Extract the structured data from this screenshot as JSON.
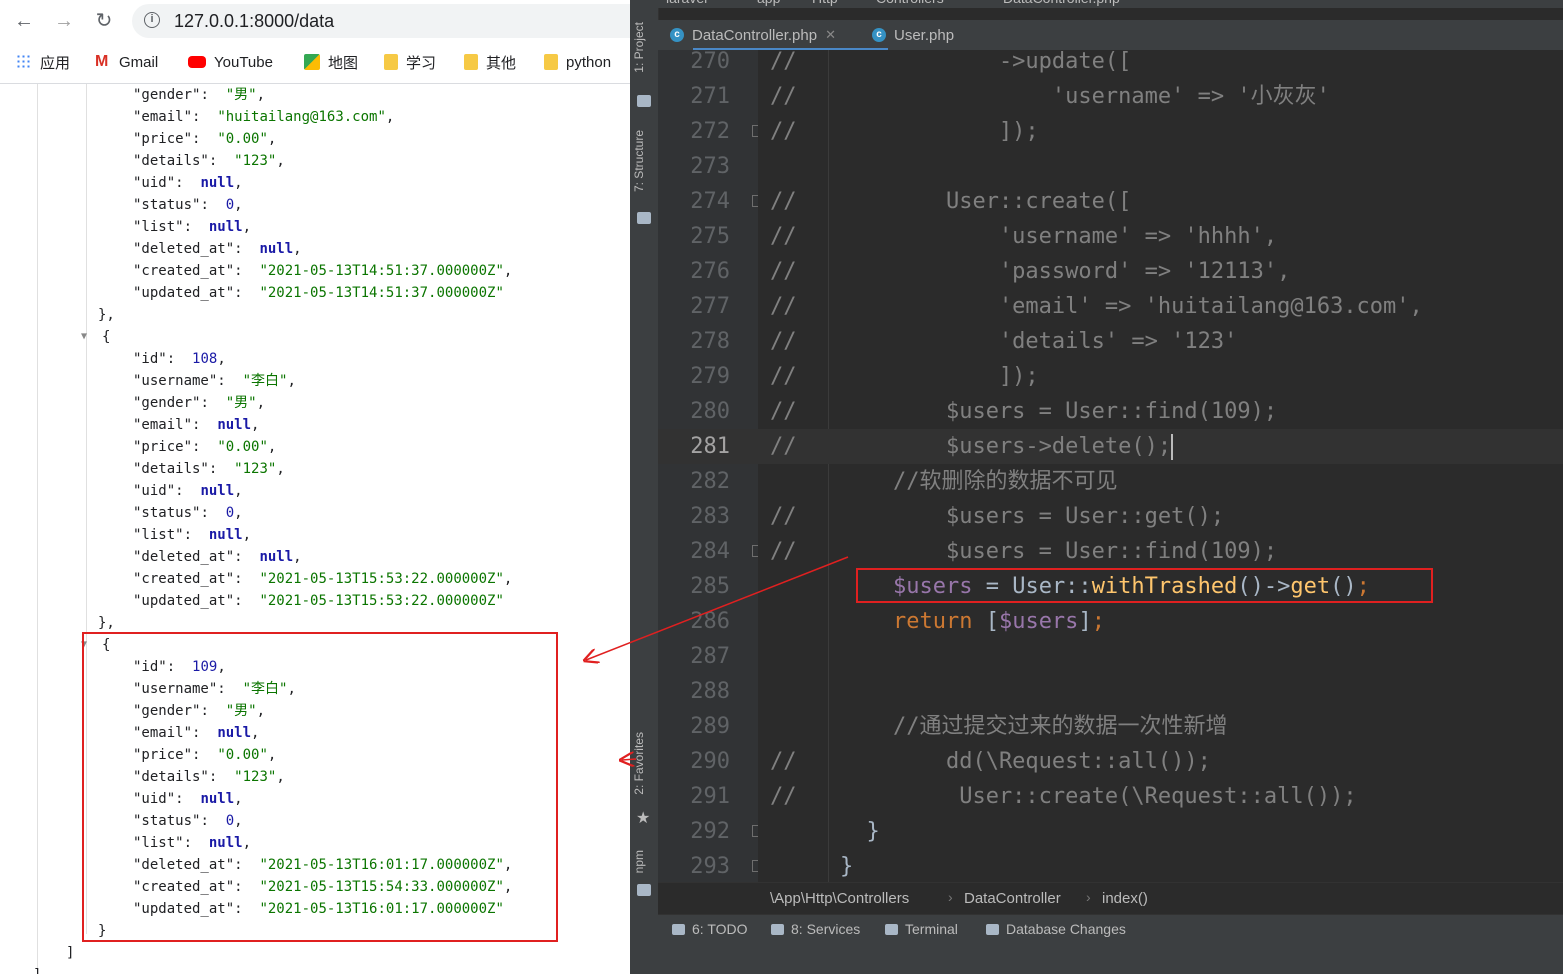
{
  "browser": {
    "url": "127.0.0.1:8000/data",
    "bookmarks": [
      {
        "label": "应用",
        "icon": "apps-grid-icon"
      },
      {
        "label": "Gmail",
        "icon": "gmail-icon"
      },
      {
        "label": "YouTube",
        "icon": "youtube-icon"
      },
      {
        "label": "地图",
        "icon": "maps-icon"
      },
      {
        "label": "学习",
        "icon": "folder-icon"
      },
      {
        "label": "其他",
        "icon": "folder-icon"
      },
      {
        "label": "python",
        "icon": "folder-icon"
      }
    ],
    "json_lines": [
      {
        "t": "kv",
        "key": "\"gender\"",
        "val": "\"男\"",
        "type": "s",
        "comma": true
      },
      {
        "t": "kv",
        "key": "\"email\"",
        "val": "\"huitailang@163.com\"",
        "type": "s",
        "comma": true
      },
      {
        "t": "kv",
        "key": "\"price\"",
        "val": "\"0.00\"",
        "type": "s",
        "comma": true
      },
      {
        "t": "kv",
        "key": "\"details\"",
        "val": "\"123\"",
        "type": "s",
        "comma": true
      },
      {
        "t": "kv",
        "key": "\"uid\"",
        "val": "null",
        "type": "nul",
        "comma": true
      },
      {
        "t": "kv",
        "key": "\"status\"",
        "val": "0",
        "type": "n",
        "comma": true
      },
      {
        "t": "kv",
        "key": "\"list\"",
        "val": "null",
        "type": "nul",
        "comma": true
      },
      {
        "t": "kv",
        "key": "\"deleted_at\"",
        "val": "null",
        "type": "nul",
        "comma": true
      },
      {
        "t": "kv",
        "key": "\"created_at\"",
        "val": "\"2021-05-13T14:51:37.000000Z\"",
        "type": "s",
        "comma": true
      },
      {
        "t": "kv",
        "key": "\"updated_at\"",
        "val": "\"2021-05-13T14:51:37.000000Z\"",
        "type": "s",
        "comma": false
      },
      {
        "t": "close",
        "text": "},"
      },
      {
        "t": "open",
        "text": "{"
      },
      {
        "t": "kv",
        "key": "\"id\"",
        "val": "108",
        "type": "n",
        "comma": true
      },
      {
        "t": "kv",
        "key": "\"username\"",
        "val": "\"李白\"",
        "type": "s",
        "comma": true
      },
      {
        "t": "kv",
        "key": "\"gender\"",
        "val": "\"男\"",
        "type": "s",
        "comma": true
      },
      {
        "t": "kv",
        "key": "\"email\"",
        "val": "null",
        "type": "nul",
        "comma": true
      },
      {
        "t": "kv",
        "key": "\"price\"",
        "val": "\"0.00\"",
        "type": "s",
        "comma": true
      },
      {
        "t": "kv",
        "key": "\"details\"",
        "val": "\"123\"",
        "type": "s",
        "comma": true
      },
      {
        "t": "kv",
        "key": "\"uid\"",
        "val": "null",
        "type": "nul",
        "comma": true
      },
      {
        "t": "kv",
        "key": "\"status\"",
        "val": "0",
        "type": "n",
        "comma": true
      },
      {
        "t": "kv",
        "key": "\"list\"",
        "val": "null",
        "type": "nul",
        "comma": true
      },
      {
        "t": "kv",
        "key": "\"deleted_at\"",
        "val": "null",
        "type": "nul",
        "comma": true
      },
      {
        "t": "kv",
        "key": "\"created_at\"",
        "val": "\"2021-05-13T15:53:22.000000Z\"",
        "type": "s",
        "comma": true
      },
      {
        "t": "kv",
        "key": "\"updated_at\"",
        "val": "\"2021-05-13T15:53:22.000000Z\"",
        "type": "s",
        "comma": false
      },
      {
        "t": "close",
        "text": "},"
      },
      {
        "t": "open",
        "text": "{"
      },
      {
        "t": "kv",
        "key": "\"id\"",
        "val": "109",
        "type": "n",
        "comma": true
      },
      {
        "t": "kv",
        "key": "\"username\"",
        "val": "\"李白\"",
        "type": "s",
        "comma": true
      },
      {
        "t": "kv",
        "key": "\"gender\"",
        "val": "\"男\"",
        "type": "s",
        "comma": true
      },
      {
        "t": "kv",
        "key": "\"email\"",
        "val": "null",
        "type": "nul",
        "comma": true
      },
      {
        "t": "kv",
        "key": "\"price\"",
        "val": "\"0.00\"",
        "type": "s",
        "comma": true
      },
      {
        "t": "kv",
        "key": "\"details\"",
        "val": "\"123\"",
        "type": "s",
        "comma": true
      },
      {
        "t": "kv",
        "key": "\"uid\"",
        "val": "null",
        "type": "nul",
        "comma": true
      },
      {
        "t": "kv",
        "key": "\"status\"",
        "val": "0",
        "type": "n",
        "comma": true
      },
      {
        "t": "kv",
        "key": "\"list\"",
        "val": "null",
        "type": "nul",
        "comma": true
      },
      {
        "t": "kv",
        "key": "\"deleted_at\"",
        "val": "\"2021-05-13T16:01:17.000000Z\"",
        "type": "s",
        "comma": true
      },
      {
        "t": "kv",
        "key": "\"created_at\"",
        "val": "\"2021-05-13T15:54:33.000000Z\"",
        "type": "s",
        "comma": true
      },
      {
        "t": "kv",
        "key": "\"updated_at\"",
        "val": "\"2021-05-13T16:01:17.000000Z\"",
        "type": "s",
        "comma": false
      },
      {
        "t": "close",
        "text": "}"
      },
      {
        "t": "close2",
        "text": "]"
      },
      {
        "t": "close3",
        "text": "]"
      }
    ]
  },
  "ide": {
    "top_breadcrumb": [
      "laravel",
      "app",
      "Http",
      "Controllers",
      "DataController.php"
    ],
    "tabs": [
      {
        "label": "DataController.php",
        "active": true
      },
      {
        "label": "User.php",
        "active": false
      }
    ],
    "side_tabs": {
      "project": "1: Project",
      "structure": "7: Structure",
      "favorites": "2: Favorites",
      "npm": "npm"
    },
    "current_line": 281,
    "lines": [
      {
        "n": 270,
        "c": "//",
        "code": [
          [
            "cmt",
            "            ->update(["
          ]
        ]
      },
      {
        "n": 271,
        "c": "//",
        "code": [
          [
            "cmt",
            "                'username' => '小灰灰'"
          ]
        ]
      },
      {
        "n": 272,
        "c": "//",
        "code": [
          [
            "cmt",
            "            ]);"
          ]
        ]
      },
      {
        "n": 273,
        "c": "",
        "code": []
      },
      {
        "n": 274,
        "c": "//",
        "code": [
          [
            "cmt",
            "        User::create(["
          ]
        ]
      },
      {
        "n": 275,
        "c": "//",
        "code": [
          [
            "cmt",
            "            'username' => 'hhhh',"
          ]
        ]
      },
      {
        "n": 276,
        "c": "//",
        "code": [
          [
            "cmt",
            "            'password' => '12113',"
          ]
        ]
      },
      {
        "n": 277,
        "c": "//",
        "code": [
          [
            "cmt",
            "            'email' => 'huitailang@163.com',"
          ]
        ]
      },
      {
        "n": 278,
        "c": "//",
        "code": [
          [
            "cmt",
            "            'details' => '123'"
          ]
        ]
      },
      {
        "n": 279,
        "c": "//",
        "code": [
          [
            "cmt",
            "            ]);"
          ]
        ]
      },
      {
        "n": 280,
        "c": "//",
        "code": [
          [
            "cmt",
            "        $users = User::find(109);"
          ]
        ]
      },
      {
        "n": 281,
        "c": "//",
        "code": [
          [
            "cmt",
            "        $users->delete();"
          ]
        ]
      },
      {
        "n": 282,
        "c": "",
        "code": [
          [
            "cmt",
            "    //软删除的数据不可见"
          ]
        ]
      },
      {
        "n": 283,
        "c": "//",
        "code": [
          [
            "cmt",
            "        $users = User::get();"
          ]
        ]
      },
      {
        "n": 284,
        "c": "//",
        "code": [
          [
            "cmt",
            "        $users = User::find(109);"
          ]
        ]
      },
      {
        "n": 285,
        "c": "",
        "code": [
          [
            "plain",
            "    "
          ],
          [
            "var",
            "$users"
          ],
          [
            "plain",
            " = User::"
          ],
          [
            "fn",
            "withTrashed"
          ],
          [
            "plain",
            "()->"
          ],
          [
            "fn",
            "get"
          ],
          [
            "plain",
            "()"
          ],
          [
            "kw",
            ";"
          ]
        ]
      },
      {
        "n": 286,
        "c": "",
        "code": [
          [
            "plain",
            "    "
          ],
          [
            "kw",
            "return "
          ],
          [
            "plain",
            "["
          ],
          [
            "var",
            "$users"
          ],
          [
            "plain",
            "]"
          ],
          [
            "kw",
            ";"
          ]
        ]
      },
      {
        "n": 287,
        "c": "",
        "code": []
      },
      {
        "n": 288,
        "c": "",
        "code": []
      },
      {
        "n": 289,
        "c": "",
        "code": [
          [
            "cmt",
            "    //通过提交过来的数据一次性新增"
          ]
        ]
      },
      {
        "n": 290,
        "c": "//",
        "code": [
          [
            "cmt",
            "        dd(\\Request::all());"
          ]
        ]
      },
      {
        "n": 291,
        "c": "//",
        "code": [
          [
            "cmt",
            "         User::create(\\Request::all());"
          ]
        ]
      },
      {
        "n": 292,
        "c": "",
        "code": [
          [
            "plain",
            "  }"
          ]
        ]
      },
      {
        "n": 293,
        "c": "",
        "code": [
          [
            "plain",
            "}"
          ]
        ]
      }
    ],
    "path_bar": [
      "\\App\\Http\\Controllers",
      "DataController",
      "index()"
    ],
    "status_items": [
      {
        "label": "6: TODO",
        "icon": "todo-icon"
      },
      {
        "label": "8: Services",
        "icon": "services-icon"
      },
      {
        "label": "Terminal",
        "icon": "terminal-icon"
      },
      {
        "label": "Database Changes",
        "icon": "database-icon"
      }
    ]
  },
  "colors": {
    "highlight_red": "#e02020",
    "ide_bg": "#2b2b2b",
    "ide_comment": "#808080",
    "ide_keyword": "#cc7832",
    "ide_var": "#9876aa",
    "ide_fn": "#ffc66d"
  }
}
